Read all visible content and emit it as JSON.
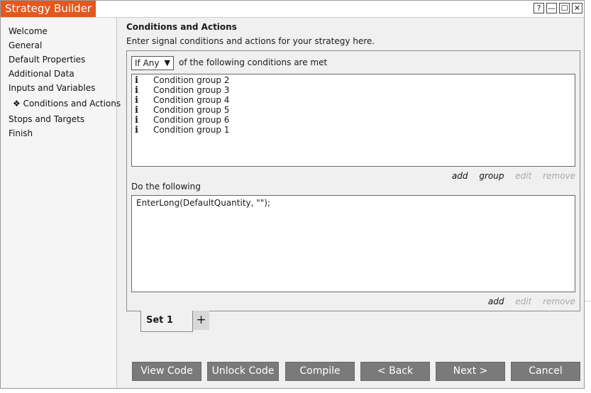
{
  "window": {
    "title": "Strategy Builder"
  },
  "title_controls": [
    "?",
    "—",
    "☐",
    "✕"
  ],
  "nav": {
    "items": [
      {
        "label": "Welcome",
        "active": false
      },
      {
        "label": "General",
        "active": false
      },
      {
        "label": "Default Properties",
        "active": false
      },
      {
        "label": "Additional Data",
        "active": false
      },
      {
        "label": "Inputs and Variables",
        "active": false
      },
      {
        "label": "❖ Conditions and Actions",
        "active": true
      },
      {
        "label": "Stops and Targets",
        "active": false
      },
      {
        "label": "Finish",
        "active": false
      }
    ]
  },
  "page": {
    "heading": "Conditions and Actions",
    "subheading": "Enter signal conditions and actions for your strategy here."
  },
  "conditions": {
    "mode_selected": "If Any",
    "mode_suffix": "of the following conditions are met",
    "items": [
      {
        "icon": "i",
        "label": "Condition group 2"
      },
      {
        "icon": "i",
        "label": "Condition group 3"
      },
      {
        "icon": "i",
        "label": "Condition group 4"
      },
      {
        "icon": "i",
        "label": "Condition group 5"
      },
      {
        "icon": "i",
        "label": "Condition group 6"
      },
      {
        "icon": "i",
        "label": "Condition group 1"
      }
    ],
    "links": {
      "add": "add",
      "group": "group",
      "edit": "edit",
      "remove": "remove"
    }
  },
  "actions": {
    "label": "Do the following",
    "text": "EnterLong(DefaultQuantity, \"\");",
    "links": {
      "add": "add",
      "edit": "edit",
      "remove": "remove"
    }
  },
  "sets": {
    "active_label": "Set 1",
    "add_label": "+"
  },
  "buttons": {
    "view_code": "View Code",
    "unlock_code": "Unlock Code",
    "compile": "Compile",
    "back": "< Back",
    "next": "Next >",
    "cancel": "Cancel"
  },
  "colors": {
    "accent": "#E2581E",
    "button_bg": "#7A7A7A",
    "disabled_text": "#A8A8A8"
  }
}
